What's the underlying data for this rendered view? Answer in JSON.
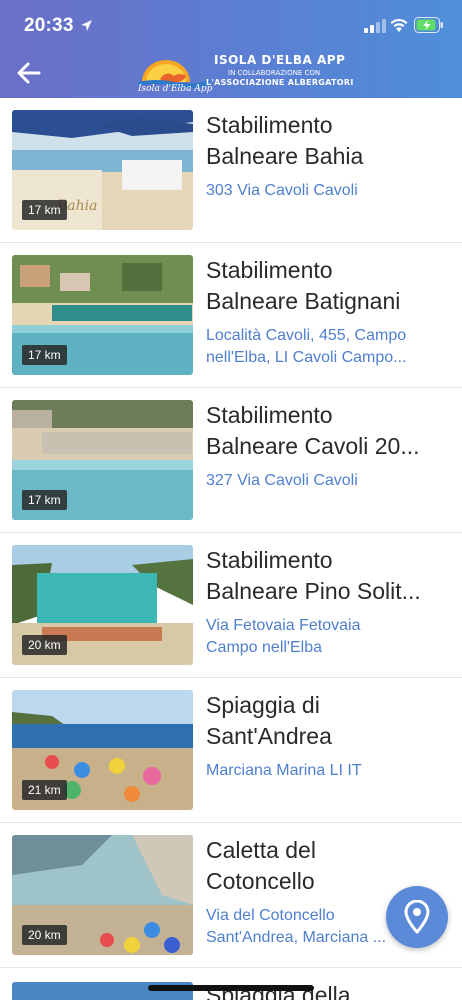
{
  "status_bar": {
    "time": "20:33"
  },
  "header": {
    "logo_caption": "Isola d'Elba App",
    "app_title": "ISOLA D'ELBA APP",
    "app_subtitle_1": "IN COLLABORAZIONE CON",
    "app_subtitle_2": "L'ASSOCIAZIONE ALBERGATORI"
  },
  "items": [
    {
      "title_line1": "Stabilimento",
      "title_line2": "Balneare Bahia",
      "address_line1": "303 Via Cavoli Cavoli",
      "address_line2": "",
      "distance": "17 km"
    },
    {
      "title_line1": "Stabilimento",
      "title_line2": "Balneare Batignani",
      "address_line1": "Località Cavoli, 455, Campo",
      "address_line2": "nell'Elba, LI Cavoli Campo...",
      "distance": "17 km"
    },
    {
      "title_line1": "Stabilimento",
      "title_line2": "Balneare Cavoli 20...",
      "address_line1": "327 Via Cavoli Cavoli",
      "address_line2": "",
      "distance": "17 km"
    },
    {
      "title_line1": "Stabilimento",
      "title_line2": "Balneare Pino Solit...",
      "address_line1": "Via Fetovaia Fetovaia",
      "address_line2": "Campo nell'Elba",
      "distance": "20 km"
    },
    {
      "title_line1": "Spiaggia di",
      "title_line2": "Sant'Andrea",
      "address_line1": "Marciana Marina LI IT",
      "address_line2": "",
      "distance": "21 km"
    },
    {
      "title_line1": "Caletta del",
      "title_line2": "Cotoncello",
      "address_line1": "Via del Cotoncello",
      "address_line2": "Sant'Andrea, Marciana ...",
      "distance": "20 km"
    }
  ],
  "partial_item": {
    "title_line1": "Spiaggia della"
  },
  "icons": {
    "back": "back-arrow-icon",
    "map": "map-pin-icon"
  },
  "colors": {
    "header_start": "#6b6fc6",
    "header_end": "#4f8fd9",
    "address": "#4f7fcf",
    "fab": "#5b8ad8"
  }
}
